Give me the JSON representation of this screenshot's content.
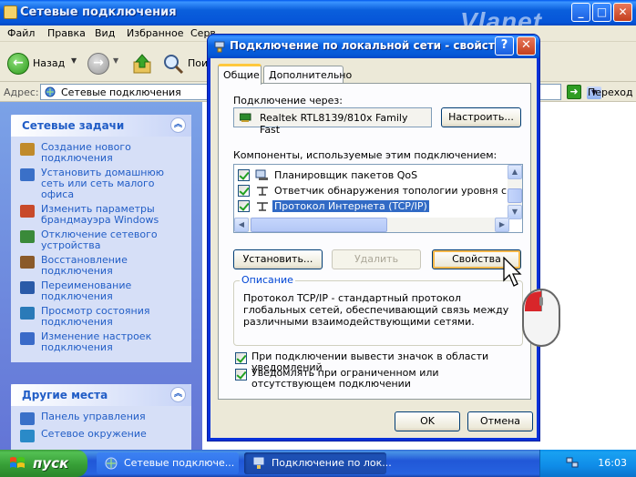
{
  "explorer": {
    "title": "Сетевые подключения",
    "brand": "Vlanet",
    "menu": [
      "Файл",
      "Правка",
      "Вид",
      "Избранное",
      "Серв"
    ],
    "toolbar": {
      "back_label": "Назад",
      "search_label": "Пои"
    },
    "address": {
      "label": "Адрес:",
      "value": "Сетевые подключения",
      "go_label": "Переход"
    }
  },
  "leftpane": {
    "tasks_panel": {
      "title": "Сетевые задачи",
      "items": [
        {
          "label": "Создание нового подключения",
          "icon": "new-connection-icon",
          "color": "#c08a2b"
        },
        {
          "label": "Установить домашнюю сеть или сеть малого офиса",
          "icon": "home-network-icon",
          "color": "#3a70c8"
        },
        {
          "label": "Изменить параметры брандмауэра Windows",
          "icon": "firewall-icon",
          "color": "#c84a2a"
        },
        {
          "label": "Отключение сетевого устройства",
          "icon": "disable-device-icon",
          "color": "#3a8a3a"
        },
        {
          "label": "Восстановление подключения",
          "icon": "repair-icon",
          "color": "#8a5a2a"
        },
        {
          "label": "Переименование подключения",
          "icon": "rename-icon",
          "color": "#2a5aa8"
        },
        {
          "label": "Просмотр состояния подключения",
          "icon": "status-icon",
          "color": "#2a7ab8"
        },
        {
          "label": "Изменение настроек подключения",
          "icon": "settings-icon",
          "color": "#3a6ac8"
        }
      ]
    },
    "places_panel": {
      "title": "Другие места",
      "items": [
        {
          "label": "Панель управления",
          "icon": "control-panel-icon",
          "color": "#3a70c8"
        },
        {
          "label": "Сетевое окружение",
          "icon": "network-places-icon",
          "color": "#2a8ac8"
        }
      ]
    }
  },
  "dialog": {
    "title": "Подключение по локальной сети - свойства",
    "tabs": [
      "Общие",
      "Дополнительно"
    ],
    "connect_using_label": "Подключение через:",
    "adapter_name": "Realtek RTL8139/810x Family Fast",
    "configure_button": "Настроить...",
    "components_label": "Компоненты, используемые этим подключением:",
    "components": [
      {
        "label": "Планировщик пакетов QoS",
        "checked": true,
        "selected": false
      },
      {
        "label": "Ответчик обнаружения топологии уровня связи",
        "checked": true,
        "selected": false
      },
      {
        "label": "Протокол Интернета (TCP/IP)",
        "checked": true,
        "selected": true
      }
    ],
    "install_button": "Установить...",
    "uninstall_button": "Удалить",
    "properties_button": "Свойства",
    "description_title": "Описание",
    "description_text": "Протокол TCP/IP - стандартный протокол глобальных сетей, обеспечивающий связь между различными взаимодействующими сетями.",
    "show_icon_option": "При подключении вывести значок в области уведомлений",
    "notify_option": "Уведомлять при ограниченном или отсутствующем подключении",
    "ok_button": "OK",
    "cancel_button": "Отмена",
    "help_glyph": "?",
    "close_glyph": "✕"
  },
  "taskbar": {
    "start_label": "пуск",
    "buttons": [
      {
        "label": "Сетевые подключе...",
        "active": false
      },
      {
        "label": "Подключение по лок...",
        "active": true
      }
    ],
    "language": "EN",
    "clock": "16:03"
  }
}
